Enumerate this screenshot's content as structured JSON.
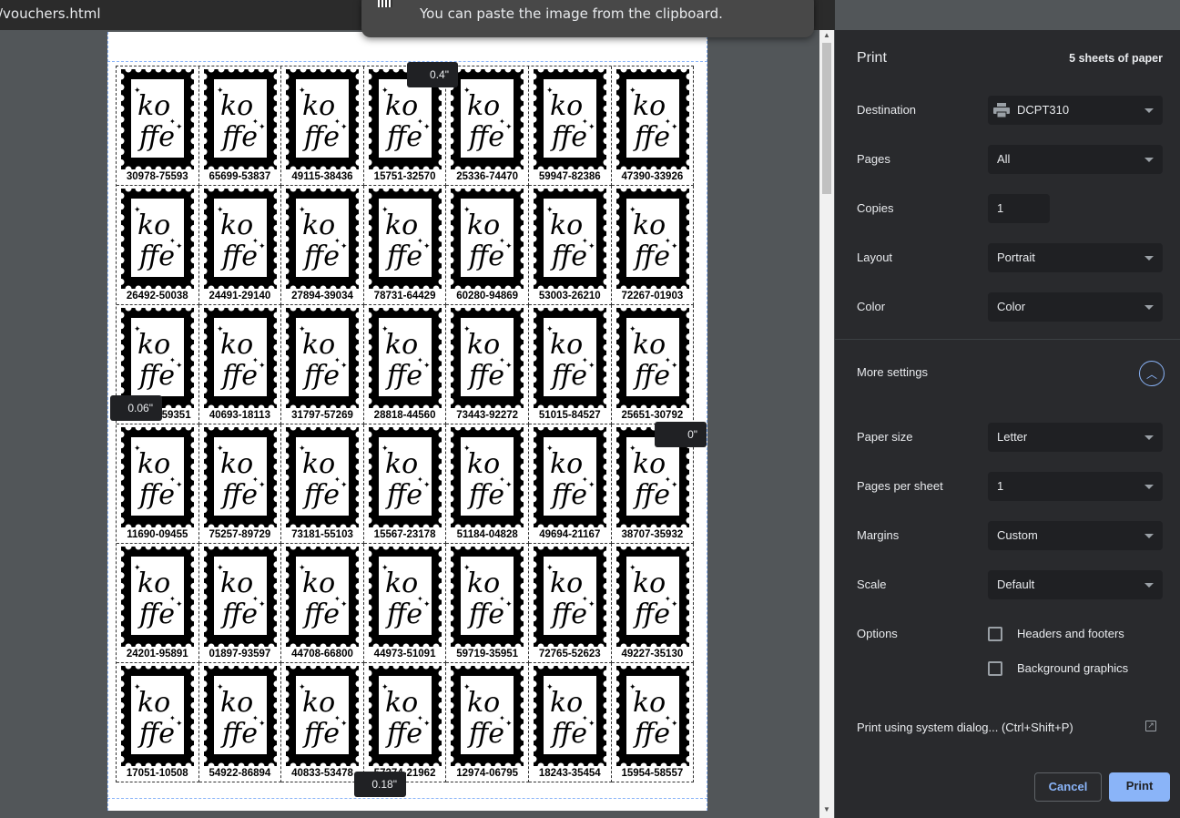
{
  "browser": {
    "tab_title": "/vouchers.html"
  },
  "toast": {
    "message": "You can paste the image from the clipboard."
  },
  "margin_tooltips": {
    "top": "0.4\"",
    "left": "0.06\"",
    "right": "0\"",
    "bottom": "0.18\""
  },
  "vouchers": {
    "brand_line1": "ko",
    "brand_line2": "ffe",
    "codes": [
      [
        "30978-75593",
        "65699-53837",
        "49115-38436",
        "15751-32570",
        "25336-74470",
        "59947-82386",
        "47390-33926"
      ],
      [
        "26492-50038",
        "24491-29140",
        "27894-39034",
        "78731-64429",
        "60280-94869",
        "53003-26210",
        "72267-01903"
      ],
      [
        "59351",
        "40693-18113",
        "31797-57269",
        "28818-44560",
        "73443-92272",
        "51015-84527",
        "25651-30792"
      ],
      [
        "11690-09455",
        "75257-89729",
        "73181-55103",
        "15567-23178",
        "51184-04828",
        "49694-21167",
        "38707-35932"
      ],
      [
        "24201-95891",
        "01897-93597",
        "44708-66800",
        "44973-51091",
        "59719-35951",
        "72765-52623",
        "49227-35130"
      ],
      [
        "17051-10508",
        "54922-86894",
        "40833-53478",
        "57274-21962",
        "12974-06795",
        "18243-35454",
        "15954-58557"
      ]
    ]
  },
  "print": {
    "title": "Print",
    "sheets": "5 sheets of paper",
    "destination": {
      "label": "Destination",
      "value": "DCPT310",
      "icon": "printer-icon"
    },
    "pages": {
      "label": "Pages",
      "value": "All"
    },
    "copies": {
      "label": "Copies",
      "value": "1"
    },
    "layout": {
      "label": "Layout",
      "value": "Portrait"
    },
    "color": {
      "label": "Color",
      "value": "Color"
    },
    "more_settings": "More settings",
    "paper_size": {
      "label": "Paper size",
      "value": "Letter"
    },
    "pages_per_sheet": {
      "label": "Pages per sheet",
      "value": "1"
    },
    "margins": {
      "label": "Margins",
      "value": "Custom"
    },
    "scale": {
      "label": "Scale",
      "value": "Default"
    },
    "options": {
      "label": "Options",
      "headers_footers": "Headers and footers",
      "background_graphics": "Background graphics"
    },
    "system_dialog": "Print using system dialog... (Ctrl+Shift+P)",
    "cancel": "Cancel",
    "print": "Print",
    "accent": "#8ab4f8"
  }
}
